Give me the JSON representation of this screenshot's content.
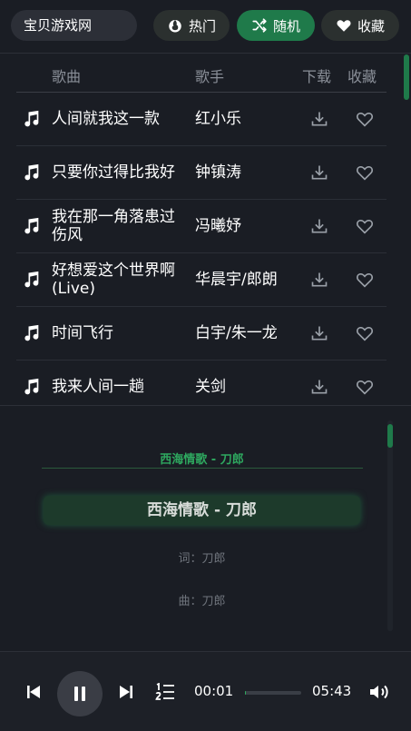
{
  "header": {
    "site_title": "宝贝游戏网",
    "hot_label": "热门",
    "random_label": "随机",
    "favorites_label": "收藏"
  },
  "song_list": {
    "columns": {
      "song": "歌曲",
      "artist": "歌手",
      "download": "下载",
      "favorite": "收藏"
    },
    "rows": [
      {
        "title": "人间就我这一款",
        "artist": "红小乐"
      },
      {
        "title": "只要你过得比我好",
        "artist": "钟镇涛"
      },
      {
        "title": "我在那一角落患过伤风",
        "artist": "冯曦妤"
      },
      {
        "title": "好想爱这个世界啊(Live)",
        "artist": "华晨宇/郎朗"
      },
      {
        "title": "时间飞行",
        "artist": "白宇/朱一龙"
      },
      {
        "title": "我来人间一趟",
        "artist": "关剑"
      }
    ]
  },
  "lyrics": {
    "song_header": "西海情歌 - 刀郎",
    "current_line": "西海情歌 - 刀郎",
    "lines": [
      "词：刀郎",
      "曲：刀郎"
    ]
  },
  "player": {
    "current_time": "00:01",
    "total_time": "05:43",
    "progress": 0.003
  },
  "colors": {
    "accent": "#2ea85f",
    "accent_button": "#1f7a4a",
    "background": "#1a1d24"
  }
}
